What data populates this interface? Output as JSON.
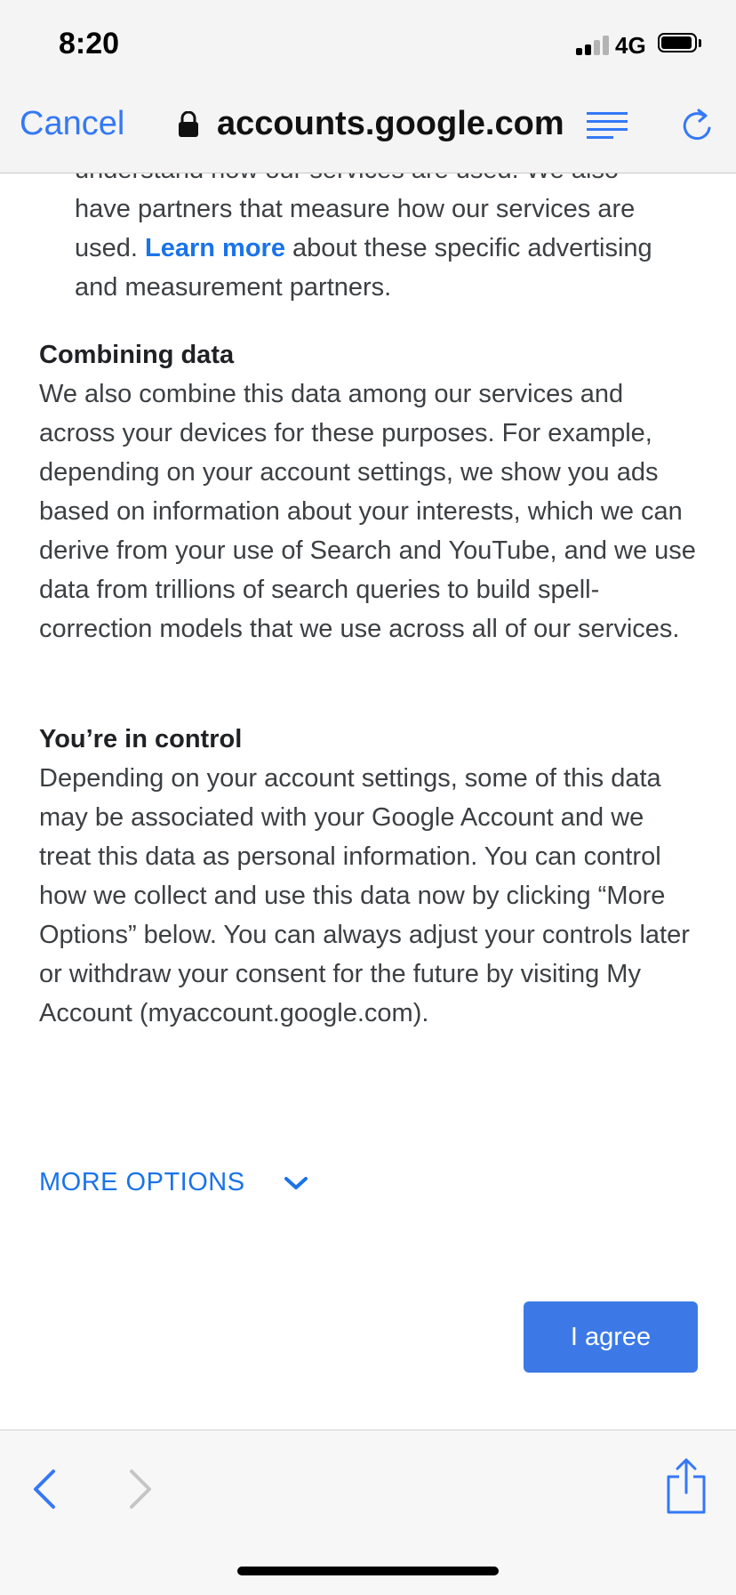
{
  "status_bar": {
    "time": "8:20",
    "network": "4G",
    "battery_icon": "battery-icon",
    "signal_icon": "signal-icon"
  },
  "nav": {
    "cancel_label": "Cancel",
    "url": "accounts.google.com",
    "lock_icon": "lock-icon",
    "reader_icon": "reader-mode-icon",
    "reload_icon": "reload-icon",
    "accent_color": "#3478f6"
  },
  "content": {
    "intro": {
      "cut_line": "understand how our services are used. We also",
      "line_before_link": "have partners that measure how our services are used.",
      "link_text": "Learn more",
      "line_after_link": "about these specific advertising and measurement partners."
    },
    "combining": {
      "heading": "Combining data",
      "body": "We also combine this data among our services and across your devices for these purposes. For example, depending on your account settings, we show you ads based on information about your interests, which we can derive from your use of Search and YouTube, and we use data from trillions of search queries to build spell-correction models that we use across all of our services."
    },
    "control": {
      "heading": "You’re in control",
      "body": "Depending on your account settings, some of this data may be associated with your Google Account and we treat this data as personal information. You can control how we collect and use this data now by clicking “More Options” below. You can always adjust your controls later or withdraw your consent for the future by visiting My Account (myaccount.google.com)."
    },
    "more_options_label": "MORE OPTIONS",
    "agree_label": "I agree",
    "link_color": "#1a73e8",
    "button_color": "#3c79e6"
  },
  "toolbar": {
    "back_icon": "back-chevron-icon",
    "forward_icon": "forward-chevron-icon",
    "share_icon": "share-icon"
  }
}
